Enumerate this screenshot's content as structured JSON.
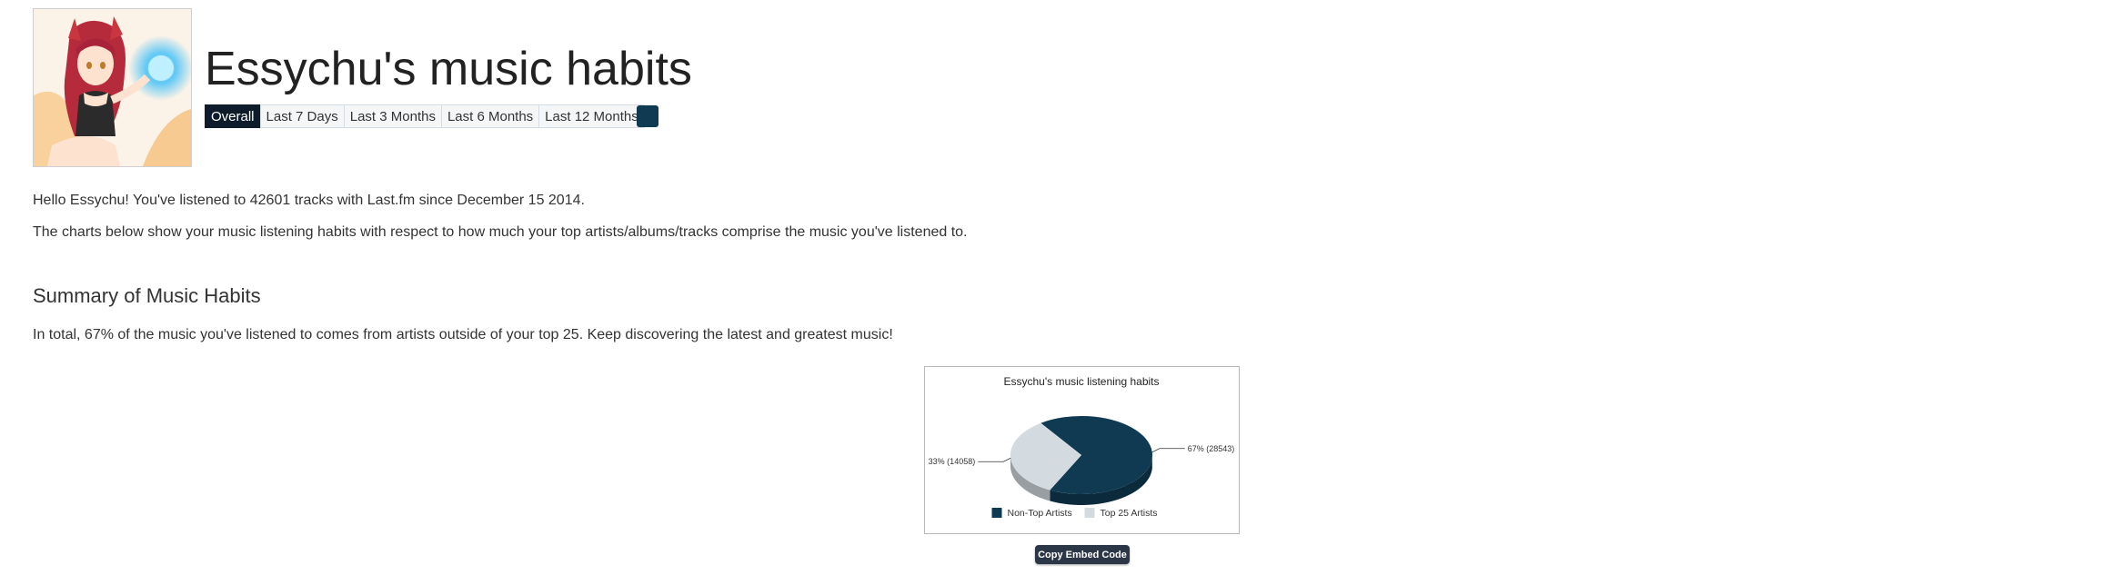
{
  "header": {
    "title": "Essychu's music habits",
    "avatar_icon": "anime-avatar-image"
  },
  "period_tabs": [
    {
      "label": "Overall",
      "active": true
    },
    {
      "label": "Last 7 Days",
      "active": false
    },
    {
      "label": "Last 3 Months",
      "active": false
    },
    {
      "label": "Last 6 Months",
      "active": false
    },
    {
      "label": "Last 12 Months",
      "active": false
    }
  ],
  "color_picker": {
    "color": "#0f3a52"
  },
  "intro": {
    "line1": "Hello Essychu! You've listened to 42601 tracks with Last.fm since December 15 2014.",
    "line2": "The charts below show your music listening habits with respect to how much your top artists/albums/tracks comprise the music you've listened to."
  },
  "summary": {
    "heading": "Summary of Music Habits",
    "text": "In total, 67% of the music you've listened to comes from artists outside of your top 25. Keep discovering the latest and greatest music!"
  },
  "chart_data": {
    "type": "pie",
    "title": "Essychu's music listening habits",
    "series": [
      {
        "name": "Non-Top Artists",
        "value": 28543,
        "label": "67%  (28543)",
        "color": "#0f3a52"
      },
      {
        "name": "Top 25 Artists",
        "value": 14058,
        "label": "33%  (14058)",
        "color": "#d3dbe1"
      }
    ],
    "legend_position": "bottom"
  },
  "embed": {
    "label": "Copy Embed Code"
  }
}
